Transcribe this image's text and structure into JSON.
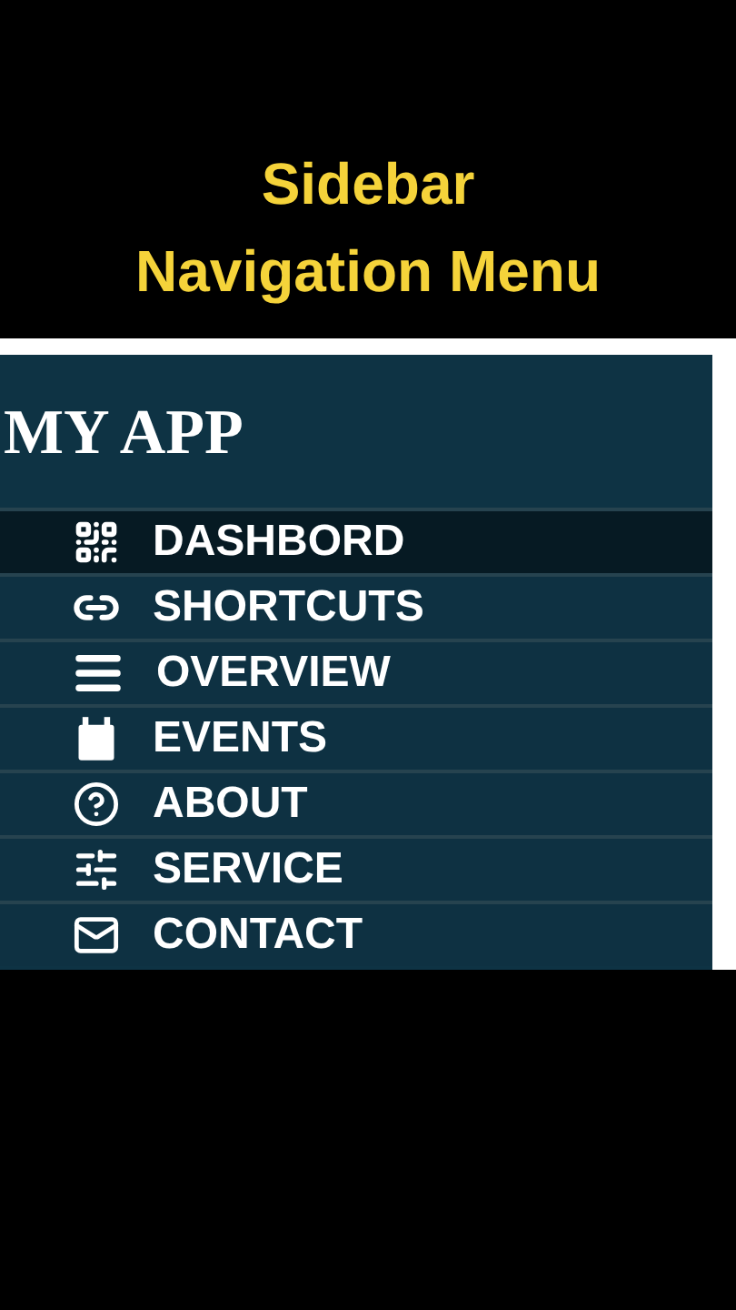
{
  "caption": [
    "Sidebar",
    "Navigation Menu"
  ],
  "sidebar": {
    "title": "MY APP",
    "items": [
      {
        "label": "DASHBORD",
        "selected": true
      },
      {
        "label": "SHORTCUTS",
        "selected": false
      },
      {
        "label": "OVERVIEW",
        "selected": false
      },
      {
        "label": "EVENTS",
        "selected": false
      },
      {
        "label": "ABOUT",
        "selected": false
      },
      {
        "label": "SERVICE",
        "selected": false
      },
      {
        "label": "CONTACT",
        "selected": false
      }
    ]
  }
}
